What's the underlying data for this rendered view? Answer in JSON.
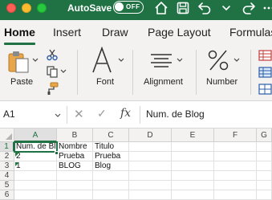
{
  "titlebar": {
    "autosave_label": "AutoSave",
    "autosave_state": "OFF",
    "icons": [
      "home-icon",
      "save-icon",
      "undo-icon",
      "redo-icon"
    ],
    "accent": "#207245"
  },
  "tabs": [
    "Home",
    "Insert",
    "Draw",
    "Page Layout",
    "Formulas"
  ],
  "active_tab": "Home",
  "ribbon": {
    "paste_label": "Paste",
    "font_label": "Font",
    "font_glyph": "A",
    "alignment_label": "Alignment",
    "number_label": "Number",
    "number_glyph": "%"
  },
  "formula_bar": {
    "name_box": "A1",
    "cancel_symbol": "✕",
    "enter_symbol": "✓",
    "fx_symbol": "fx",
    "value": "Num. de Blog"
  },
  "sheet": {
    "columns": [
      "A",
      "B",
      "C",
      "D",
      "E",
      "F",
      "G"
    ],
    "rows": [
      "1",
      "2",
      "3",
      "4",
      "5",
      "6"
    ],
    "cells": {
      "A1": "Num. de Blog",
      "B1": "Nombre",
      "C1": "Titulo",
      "A2": "2",
      "B2": "Prueba",
      "C2": "Prueba",
      "A3": "1",
      "B3": "BLOG",
      "C3": "Blog"
    },
    "selected_cell": "A1"
  }
}
